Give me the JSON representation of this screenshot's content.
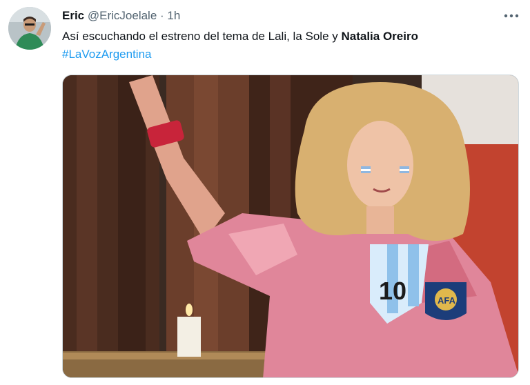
{
  "tweet": {
    "author_name": "Eric",
    "author_handle": "@EricJoelale",
    "separator": "·",
    "time": "1h",
    "text_before": "Así escuchando el estreno del tema de Lali, la Sole y ",
    "text_bold": "Natalia Oreiro",
    "hashtag": "#LaVozArgentina",
    "jersey_number": "10",
    "crest_text": "AFA"
  },
  "icons": {
    "more": "more-horizontal-icon",
    "avatar": "avatar"
  },
  "colors": {
    "hashtag": "#1d9bf0",
    "secondary_text": "#536471"
  }
}
